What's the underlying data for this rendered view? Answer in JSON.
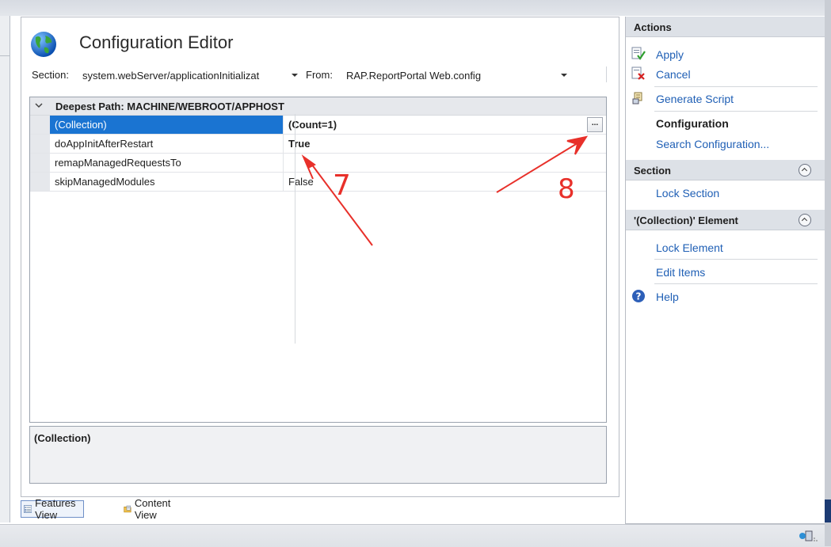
{
  "editor": {
    "title": "Configuration Editor",
    "section_label": "Section:",
    "section_value": "system.webServer/applicationInitializat",
    "from_label": "From:",
    "from_value": "RAP.ReportPortal Web.config"
  },
  "grid": {
    "header": "Deepest Path: MACHINE/WEBROOT/APPHOST",
    "rows": [
      {
        "name": "(Collection)",
        "value": "(Count=1)"
      },
      {
        "name": "doAppInitAfterRestart",
        "value": "True"
      },
      {
        "name": "remapManagedRequestsTo",
        "value": ""
      },
      {
        "name": "skipManagedModules",
        "value": "False"
      }
    ],
    "ellipsis": "..."
  },
  "description": {
    "title": "(Collection)"
  },
  "views": {
    "features": "Features View",
    "content": "Content View"
  },
  "actions": {
    "header": "Actions",
    "apply": "Apply",
    "cancel": "Cancel",
    "generate_script": "Generate Script",
    "configuration": "Configuration",
    "search_configuration": "Search Configuration...",
    "section_header": "Section",
    "lock_section": "Lock Section",
    "element_header": "'(Collection)' Element",
    "lock_element": "Lock Element",
    "edit_items": "Edit Items",
    "help": "Help"
  },
  "annotations": {
    "seven": "7",
    "eight": "8"
  },
  "colors": {
    "selection": "#1a74d2",
    "link": "#1f5fb5",
    "annotation": "#e8302a"
  }
}
